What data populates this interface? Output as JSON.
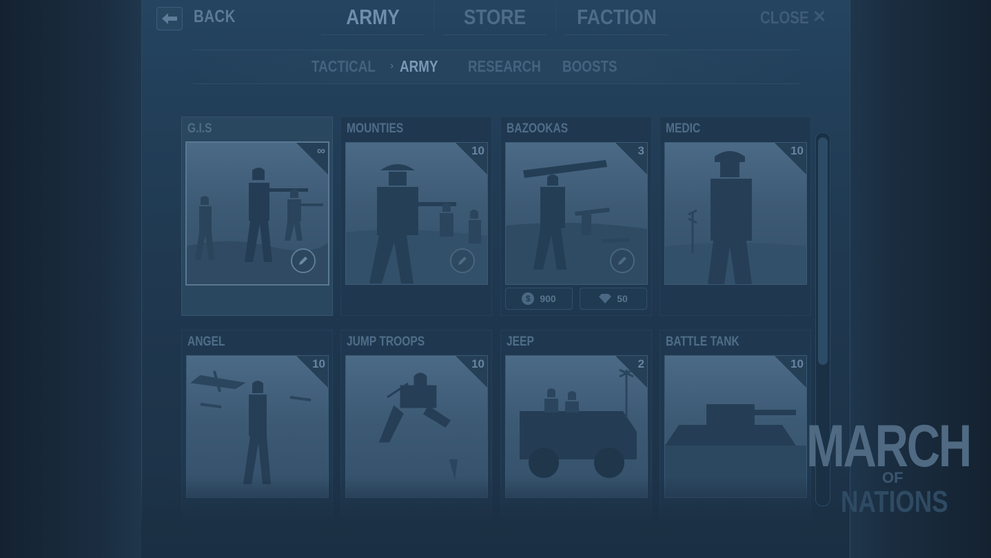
{
  "nav": {
    "back_label": "BACK",
    "tabs": [
      {
        "label": "ARMY",
        "active": true
      },
      {
        "label": "STORE",
        "active": false
      },
      {
        "label": "FACTION",
        "active": false
      }
    ],
    "close_label": "CLOSE"
  },
  "subnav": {
    "tabs": [
      {
        "label": "TACTICAL",
        "active": false
      },
      {
        "label": "ARMY",
        "active": true
      },
      {
        "label": "RESEARCH",
        "active": false
      },
      {
        "label": "BOOSTS",
        "active": false
      }
    ]
  },
  "cards": [
    {
      "title": "G.I.S",
      "count": "∞",
      "selected": true
    },
    {
      "title": "MOUNTIES",
      "count": "10"
    },
    {
      "title": "BAZOOKAS",
      "count": "3",
      "price_coins": "900",
      "price_gems": "50"
    },
    {
      "title": "MEDIC",
      "count": "10"
    },
    {
      "title": "ANGEL",
      "count": "10"
    },
    {
      "title": "JUMP TROOPS",
      "count": "10"
    },
    {
      "title": "JEEP",
      "count": "2"
    },
    {
      "title": "BATTLE TANK",
      "count": "10"
    }
  ],
  "logo": {
    "main": "MARCH",
    "of": "OF",
    "sub": "NATIONS"
  },
  "colors": {
    "accent": "#6e8eab",
    "panel": "#213c55",
    "background": "#1b2d40"
  },
  "icons": {
    "back": "back-arrow-icon",
    "edit": "pencil-icon",
    "coin": "coin-icon",
    "gem": "gem-icon"
  }
}
